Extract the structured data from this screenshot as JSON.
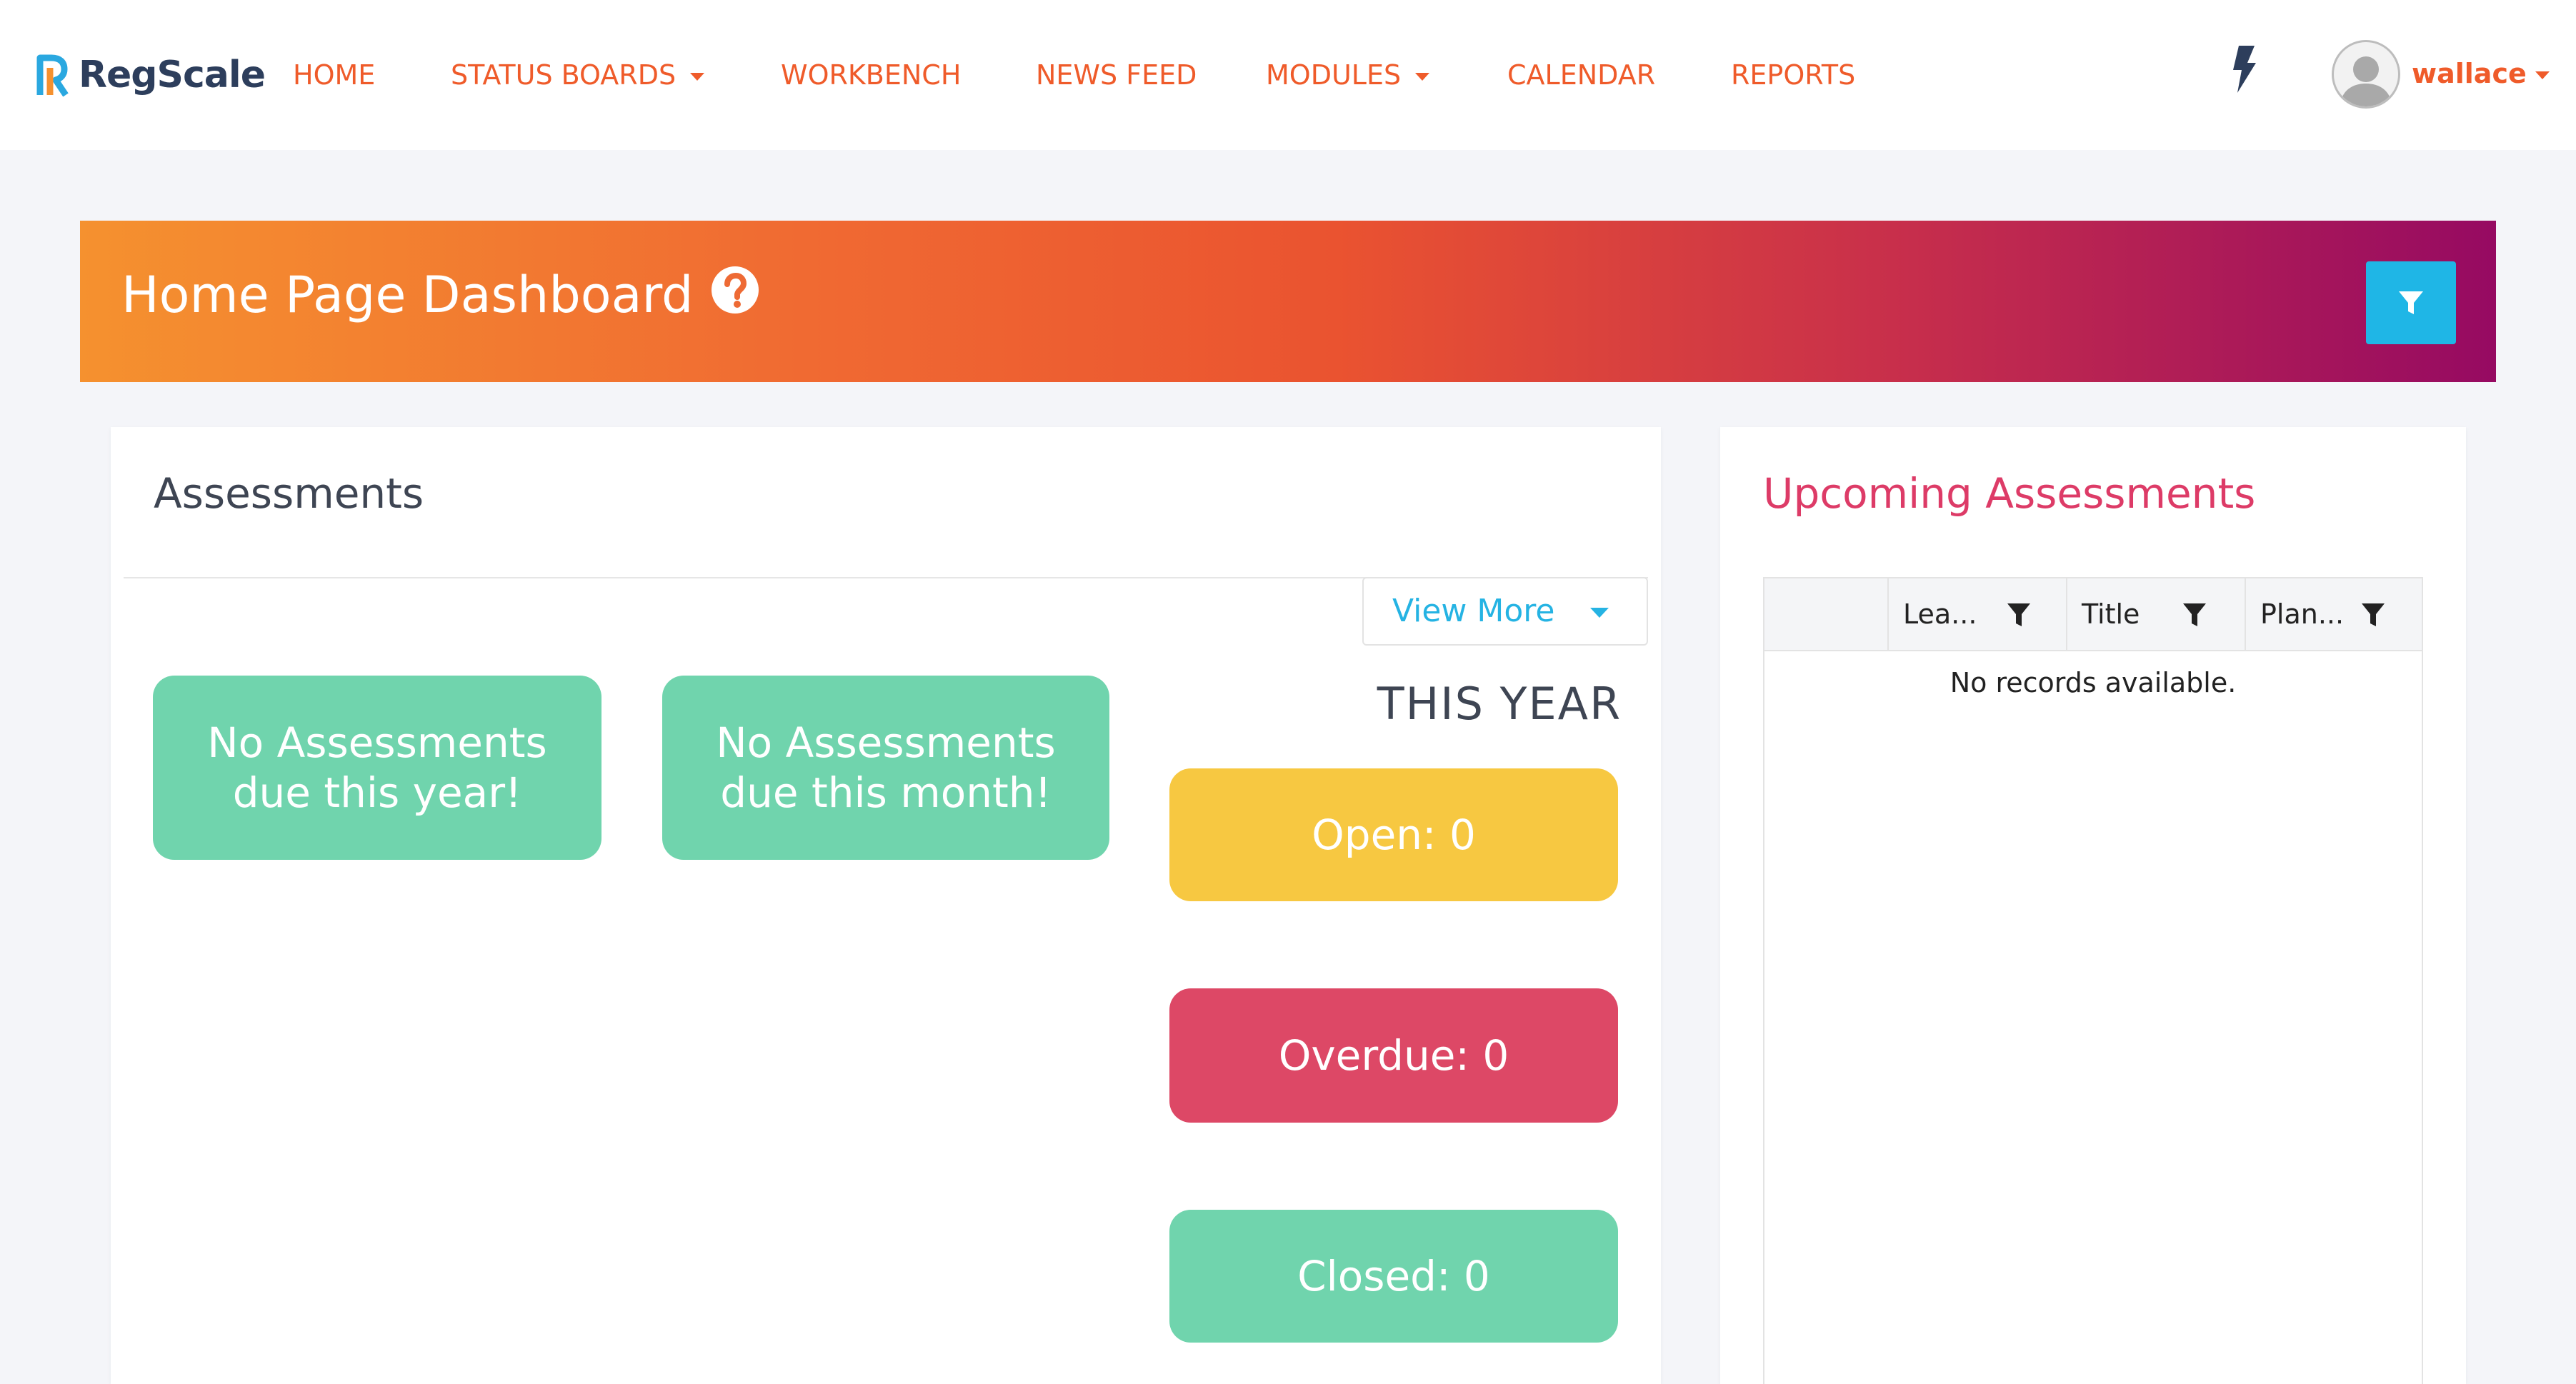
{
  "brand": {
    "name": "RegScale"
  },
  "nav": {
    "home": "HOME",
    "status_boards": "STATUS BOARDS",
    "workbench": "WORKBENCH",
    "news_feed": "NEWS FEED",
    "modules": "MODULES",
    "calendar": "CALENDAR",
    "reports": "REPORTS",
    "user": "wallace"
  },
  "banner": {
    "title": "Home Page Dashboard"
  },
  "assessments": {
    "title": "Assessments",
    "view_more": "View More",
    "due_year": "No Assessments due this year!",
    "due_month": "No Assessments due this month!",
    "this_year": "THIS YEAR",
    "open": "Open: 0",
    "overdue": "Overdue: 0",
    "closed": "Closed: 0"
  },
  "upcoming": {
    "title": "Upcoming Assessments",
    "columns": [
      "Lea...",
      "Title",
      "Plan..."
    ],
    "empty": "No records available."
  },
  "colors": {
    "nav_link": "#ef5b2a",
    "filter_button": "#1fb6e6",
    "green": "#70d4ad",
    "yellow": "#f7c841",
    "red": "#dd4866",
    "accent_title": "#dd3b67"
  },
  "icons": [
    "lightning-icon",
    "user-avatar-icon",
    "help-circle-icon",
    "filter-icon",
    "chevron-down-icon"
  ]
}
